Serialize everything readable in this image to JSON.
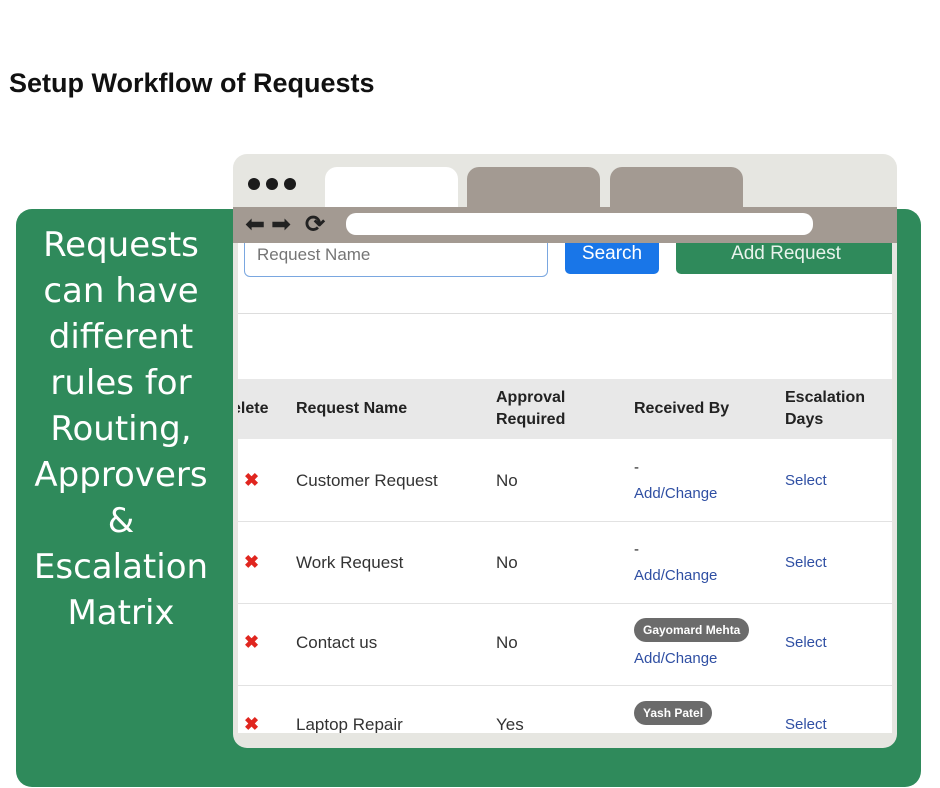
{
  "page_title": "Setup Workflow of Requests",
  "tagline_lines": [
    "Requests",
    "can have",
    "different",
    "rules for",
    "Routing,",
    "Approvers &",
    "Escalation",
    "Matrix"
  ],
  "browser": {
    "back_glyph": "⬅",
    "forward_glyph": "➡",
    "reload_glyph": "⟳"
  },
  "search": {
    "placeholder": "Request Name",
    "button_label": "Search"
  },
  "add_button_label": "Add Request",
  "table": {
    "headers": {
      "delete": "elete",
      "request_name": "Request Name",
      "approval_required_1": "Approval",
      "approval_required_2": "Required",
      "received_by": "Received By",
      "escalation_days_1": "Escalation",
      "escalation_days_2": "Days"
    },
    "rows": [
      {
        "name": "Customer Request",
        "approval": "No",
        "received_by": "-",
        "link": "Add/Change",
        "escalation": "Select"
      },
      {
        "name": "Work Request",
        "approval": "No",
        "received_by": "-",
        "link": "Add/Change",
        "escalation": "Select"
      },
      {
        "name": "Contact us",
        "approval": "No",
        "received_by_chip": "Gayomard Mehta",
        "link": "Add/Change",
        "escalation": "Select"
      },
      {
        "name": "Laptop Repair",
        "approval": "Yes",
        "received_by_chip": "Yash Patel",
        "escalation": "Select"
      }
    ],
    "delete_glyph": "✖"
  },
  "colors": {
    "brand_green": "#2f8a5b",
    "primary_blue": "#1976e8",
    "chrome_tab": "#a39a92",
    "delete_red": "#e0261f"
  }
}
